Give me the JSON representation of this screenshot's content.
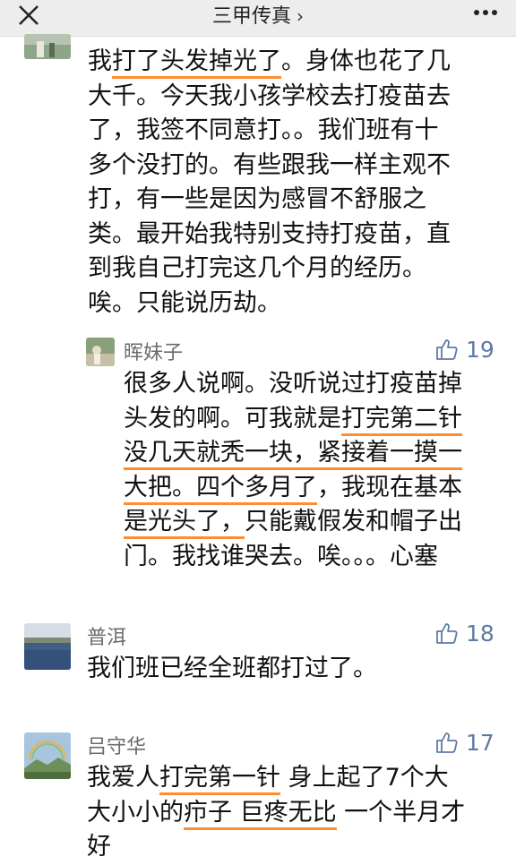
{
  "header": {
    "title": "三甲传真",
    "close_icon": "close-icon",
    "more_icon": "more-icon"
  },
  "comments": [
    {
      "text_lines": [
        [
          "我",
          {
            "hl": "打了头发掉光了"
          },
          "。身体也花了几"
        ],
        [
          "大千。今天我小孩学校去打疫苗去"
        ],
        [
          "了，我签不同意打。。我们班有十"
        ],
        [
          "多个没打的。有些跟我一样主观不"
        ],
        [
          "打，有一些是因为感冒不舒服之"
        ],
        [
          "类。最开始我特别支持打疫苗，直"
        ],
        [
          "到我自己打完这几个月的经历。"
        ],
        [
          "唉。只能说历劫。"
        ]
      ]
    },
    {
      "name": "晖妹子",
      "likes": "19",
      "text_lines": [
        [
          "很多人说啊。没听说过打疫苗掉"
        ],
        [
          "头发的啊。可我就是",
          {
            "hl": "打完第二针"
          }
        ],
        [
          {
            "hl": "没几天就秃一块，紧接着一摸一"
          }
        ],
        [
          {
            "hl": "大把。四个多月了"
          },
          "，我现在基本"
        ],
        [
          {
            "hl": "是光头了，"
          },
          "只能戴假发和帽子出"
        ],
        [
          "门。我找谁哭去。唉。。。心塞"
        ]
      ]
    },
    {
      "name": "普洱",
      "likes": "18",
      "text_lines": [
        [
          "我们班已经全班都打过了。"
        ]
      ]
    },
    {
      "name": "吕守华",
      "likes": "17",
      "text_lines": [
        [
          "我爱人",
          {
            "hl": "打完第一针"
          },
          " 身上起了7个大"
        ],
        [
          "大小小的",
          {
            "hl": "疖子 巨疼无比"
          },
          " 一个半月才"
        ],
        [
          "好"
        ]
      ]
    }
  ],
  "colors": {
    "highlight_underline": "#ff8c2e",
    "like_color": "#5f7aa6",
    "name_color": "#6b6b6b"
  }
}
